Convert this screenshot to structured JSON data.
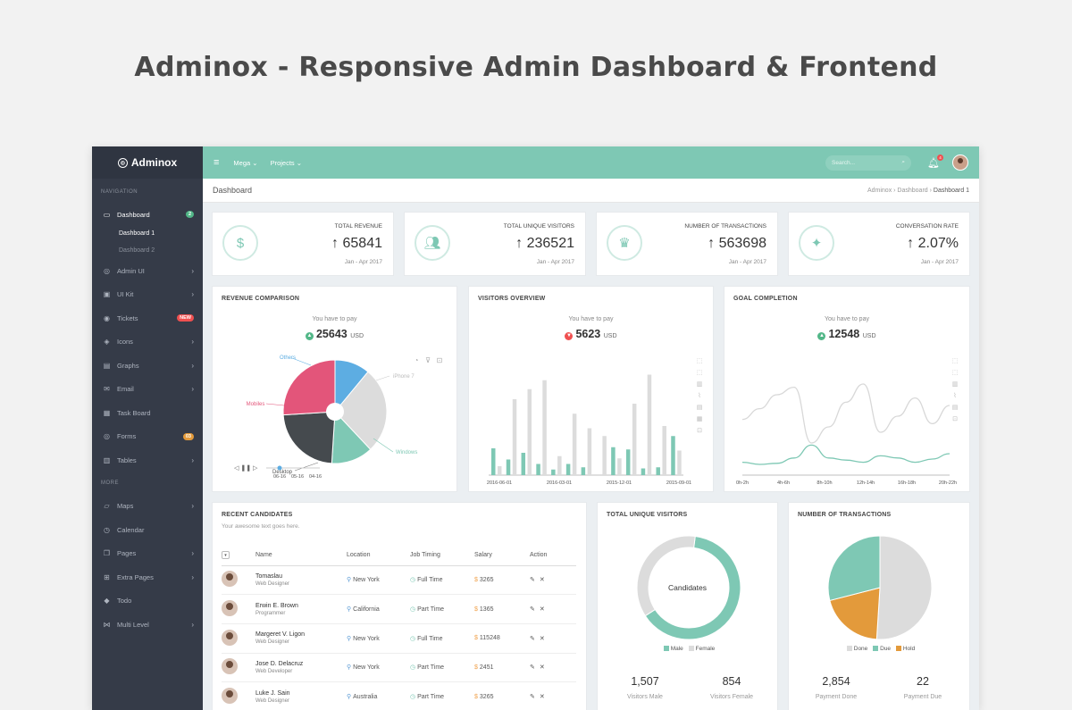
{
  "hero_title": "Adminox - Responsive Admin Dashboard & Frontend",
  "brand": "Adminox",
  "sidebar": {
    "section_nav": "NAVIGATION",
    "section_more": "MORE",
    "dashboard": {
      "label": "Dashboard",
      "badge": "2",
      "icon": "monitor-icon"
    },
    "subitems": [
      "Dashboard 1",
      "Dashboard 2"
    ],
    "items": [
      {
        "label": "Admin UI",
        "icon": "target-icon"
      },
      {
        "label": "UI Kit",
        "icon": "briefcase-icon"
      },
      {
        "label": "Tickets",
        "icon": "lifebuoy-icon",
        "badge": "NEW"
      },
      {
        "label": "Icons",
        "icon": "cube-icon"
      },
      {
        "label": "Graphs",
        "icon": "chart-icon"
      },
      {
        "label": "Email",
        "icon": "mail-icon"
      },
      {
        "label": "Task Board",
        "icon": "calendar-icon"
      },
      {
        "label": "Forms",
        "icon": "disc-icon",
        "badge": "03"
      },
      {
        "label": "Tables",
        "icon": "table-icon"
      }
    ],
    "more_items": [
      {
        "label": "Maps",
        "icon": "map-icon"
      },
      {
        "label": "Calendar",
        "icon": "clock-icon"
      },
      {
        "label": "Pages",
        "icon": "copy-icon"
      },
      {
        "label": "Extra Pages",
        "icon": "plus-square-icon"
      },
      {
        "label": "Todo",
        "icon": "layers-icon"
      },
      {
        "label": "Multi Level",
        "icon": "share-icon"
      }
    ]
  },
  "topbar": {
    "menu1": "Mega",
    "menu2": "Projects",
    "search_placeholder": "Search...",
    "notif_count": "4"
  },
  "breadcrumb": {
    "page_title": "Dashboard",
    "items": [
      "Adminox",
      "Dashboard",
      "Dashboard 1"
    ]
  },
  "stats": [
    {
      "title": "Total Revenue",
      "value": "65841",
      "sub": "Jan - Apr 2017",
      "icon": "dollar-icon"
    },
    {
      "title": "Total Unique Visitors",
      "value": "236521",
      "sub": "Jan - Apr 2017",
      "icon": "users-icon"
    },
    {
      "title": "Number of Transactions",
      "value": "563698",
      "sub": "Jan - Apr 2017",
      "icon": "crown-icon"
    },
    {
      "title": "Conversation Rate",
      "value": "2.07%",
      "sub": "Jan - Apr 2017",
      "icon": "magic-wand-icon"
    }
  ],
  "revenue": {
    "title": "Revenue Comparison",
    "pay_label": "You have to pay",
    "amount": "25643",
    "currency": "USD",
    "timeline_dates": [
      "06-16",
      "05-16",
      "04-16"
    ]
  },
  "visitors": {
    "title": "Visitors Overview",
    "pay_label": "You have to pay",
    "amount": "5623",
    "currency": "USD"
  },
  "goal": {
    "title": "Goal Completion",
    "pay_label": "You have to pay",
    "amount": "12548",
    "currency": "USD"
  },
  "colors": {
    "accent": "#7ec8b4",
    "grey": "#dcdcdc",
    "pink": "#e3557a",
    "blue": "#5dade2",
    "dark": "#454a4e",
    "orange": "#e39a3b",
    "red": "#f05050",
    "sidebar": "#353b48"
  },
  "chart_data": [
    {
      "type": "pie",
      "title": "Revenue Comparison",
      "labels": [
        "Others",
        "iPhone 7",
        "Windows",
        "Desktop",
        "Mobiles"
      ],
      "values": [
        11,
        27,
        13,
        23,
        26
      ]
    },
    {
      "type": "bar",
      "title": "Visitors Overview",
      "x_ticks": [
        "2016-06-01",
        "2016-03-01",
        "2015-12-01",
        "2015-09-01"
      ],
      "series": [
        {
          "values": [
            8,
            68,
            77,
            85,
            17,
            55,
            42,
            35,
            15,
            64,
            90,
            44,
            22
          ]
        },
        {
          "values": [
            24,
            14,
            20,
            10,
            5,
            10,
            7,
            0,
            25,
            23,
            6,
            7,
            35
          ]
        }
      ],
      "ylim": [
        0,
        100
      ]
    },
    {
      "type": "line",
      "title": "Goal Completion",
      "x_ticks": [
        "0h-2h",
        "4h-6h",
        "8h-10h",
        "12h-14h",
        "16h-18h",
        "20h-22h"
      ],
      "series": [
        {
          "values": [
            52,
            62,
            75,
            82,
            30,
            45,
            68,
            85,
            40,
            55,
            72,
            48,
            65
          ]
        },
        {
          "values": [
            12,
            10,
            11,
            16,
            28,
            16,
            14,
            12,
            18,
            16,
            12,
            15,
            20
          ]
        }
      ],
      "ylim": [
        0,
        100
      ]
    },
    {
      "type": "pie",
      "title": "Total Unique Visitors",
      "center_label": "Candidates",
      "labels": [
        "Male",
        "Female"
      ],
      "values": [
        1507,
        854
      ]
    },
    {
      "type": "pie",
      "title": "Number of Transactions",
      "labels": [
        "Done",
        "Due",
        "Hold"
      ],
      "values": [
        51,
        20,
        29
      ]
    }
  ],
  "candidates": {
    "title": "Recent Candidates",
    "subtitle": "Your awesome text goes here.",
    "columns": [
      "Name",
      "Location",
      "Job Timing",
      "Salary",
      "Action"
    ],
    "rows": [
      {
        "name": "Tomaslau",
        "role": "Web Designer",
        "location": "New York",
        "timing": "Full Time",
        "salary": "3265"
      },
      {
        "name": "Erwin E. Brown",
        "role": "Programmer",
        "location": "California",
        "timing": "Part Time",
        "salary": "1365"
      },
      {
        "name": "Margeret V. Ligon",
        "role": "Web Designer",
        "location": "New York",
        "timing": "Full Time",
        "salary": "115248"
      },
      {
        "name": "Jose D. Delacruz",
        "role": "Web Developer",
        "location": "New York",
        "timing": "Part Time",
        "salary": "2451"
      },
      {
        "name": "Luke J. Sain",
        "role": "Web Designer",
        "location": "Australia",
        "timing": "Part Time",
        "salary": "3265"
      }
    ]
  },
  "unique_visitors": {
    "title": "Total Unique Visitors",
    "center": "Candidates",
    "legend": [
      "Male",
      "Female"
    ],
    "male": "1,507",
    "male_label": "Visitors Male",
    "female": "854",
    "female_label": "Visitors Female"
  },
  "transactions": {
    "title": "Number of Transactions",
    "legend": [
      "Done",
      "Due",
      "Hold"
    ],
    "done": "2,854",
    "done_label": "Payment Done",
    "due": "22",
    "due_label": "Payment Due"
  }
}
